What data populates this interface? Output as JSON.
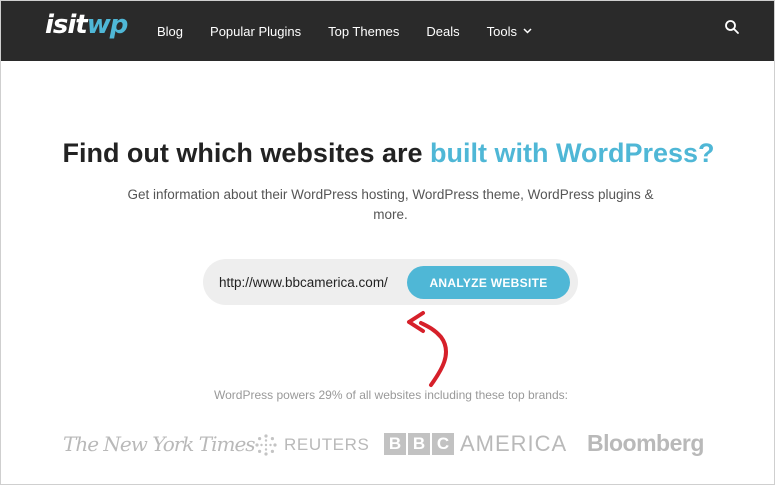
{
  "brand": {
    "logo_part1": "isit",
    "logo_part2": "wp"
  },
  "nav": {
    "items": [
      {
        "label": "Blog"
      },
      {
        "label": "Popular Plugins"
      },
      {
        "label": "Top Themes"
      },
      {
        "label": "Deals"
      },
      {
        "label": "Tools",
        "has_dropdown": true
      }
    ],
    "search_icon": "search-icon"
  },
  "hero": {
    "headline_plain": "Find out which websites are ",
    "headline_highlight": "built with WordPress?",
    "subtitle": "Get information about their WordPress hosting, WordPress theme, WordPress plugins & more."
  },
  "form": {
    "url_value": "http://www.bbcamerica.com/",
    "button_label": "ANALYZE WEBSITE"
  },
  "brands": {
    "intro": "WordPress powers 29% of all websites including these top brands:",
    "logos": {
      "nyt": "The New York Times",
      "reuters": "REUTERS",
      "bbc_letters": [
        "B",
        "B",
        "C"
      ],
      "bbc_america": "AMERICA",
      "bloomberg": "Bloomberg"
    }
  },
  "colors": {
    "nav_bg": "#2a2a2a",
    "accent": "#4fb7d6",
    "arrow": "#d6202a",
    "brand_gray": "#b9b9b9"
  }
}
